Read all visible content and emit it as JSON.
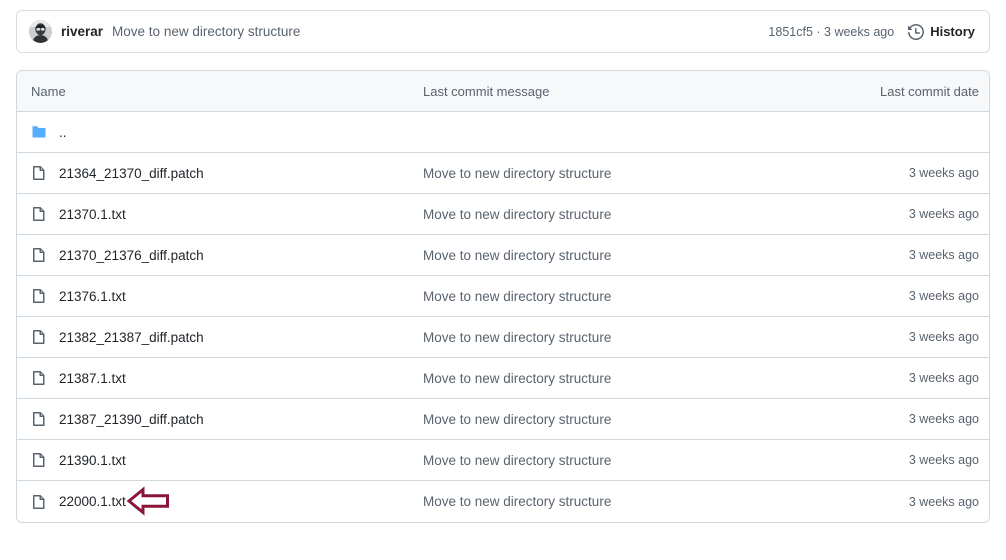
{
  "commit_header": {
    "author": "riverar",
    "message": "Move to new directory structure",
    "meta": "1851cf5 · 3 weeks ago",
    "history_label": "History",
    "history_icon": "history-clock-icon",
    "avatar_icon": "user-avatar"
  },
  "table": {
    "columns": {
      "name": "Name",
      "message": "Last commit message",
      "date": "Last commit date"
    },
    "rows": [
      {
        "name": "..",
        "icon": "folder-icon",
        "kind": "directory",
        "message": "",
        "date": ""
      },
      {
        "name": "21364_21370_diff.patch",
        "icon": "file-icon",
        "kind": "file",
        "message": "Move to new directory structure",
        "date": "3 weeks ago"
      },
      {
        "name": "21370.1.txt",
        "icon": "file-icon",
        "kind": "file",
        "message": "Move to new directory structure",
        "date": "3 weeks ago"
      },
      {
        "name": "21370_21376_diff.patch",
        "icon": "file-icon",
        "kind": "file",
        "message": "Move to new directory structure",
        "date": "3 weeks ago"
      },
      {
        "name": "21376.1.txt",
        "icon": "file-icon",
        "kind": "file",
        "message": "Move to new directory structure",
        "date": "3 weeks ago"
      },
      {
        "name": "21382_21387_diff.patch",
        "icon": "file-icon",
        "kind": "file",
        "message": "Move to new directory structure",
        "date": "3 weeks ago"
      },
      {
        "name": "21387.1.txt",
        "icon": "file-icon",
        "kind": "file",
        "message": "Move to new directory structure",
        "date": "3 weeks ago"
      },
      {
        "name": "21387_21390_diff.patch",
        "icon": "file-icon",
        "kind": "file",
        "message": "Move to new directory structure",
        "date": "3 weeks ago"
      },
      {
        "name": "21390.1.txt",
        "icon": "file-icon",
        "kind": "file",
        "message": "Move to new directory structure",
        "date": "3 weeks ago"
      },
      {
        "name": "22000.1.txt",
        "icon": "file-icon",
        "kind": "file",
        "message": "Move to new directory structure",
        "date": "3 weeks ago",
        "annotated": true
      }
    ]
  },
  "annotation": {
    "shape": "left-pointing-arrow",
    "target_row": "22000.1.txt",
    "color": "#8B1538"
  },
  "colors": {
    "folder_blue": "#54AEFF",
    "border": "#d1d9e0",
    "header_background": "#f6f8fa",
    "text_primary": "#1f2328",
    "text_muted": "#59636e",
    "annotation": "#8B1538"
  }
}
